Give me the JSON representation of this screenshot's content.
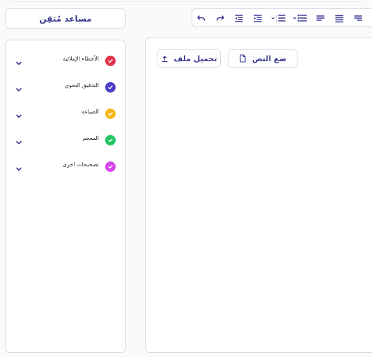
{
  "assistant_button": {
    "label": "مساعد مُتقِن"
  },
  "toolbar": {
    "icons": [
      "undo-icon",
      "redo-icon",
      "indent-decrease-icon",
      "indent-increase-icon",
      "numbered-list-icon",
      "bulleted-list-icon",
      "align-right-icon",
      "align-center-icon",
      "align-left-icon"
    ]
  },
  "sidebar": {
    "categories": [
      {
        "label": "الأخطاء الإملائية",
        "color": "#e0344a"
      },
      {
        "label": "التدقيق النحوي",
        "color": "#4c3fc9"
      },
      {
        "label": "الصياغة",
        "color": "#f5b91a"
      },
      {
        "label": "المعجم",
        "color": "#22c55e"
      },
      {
        "label": "تصحيحات اخرى",
        "color": "#d946ef"
      }
    ]
  },
  "editor": {
    "paste_label": "ضع النص",
    "upload_label": "تحميل ملف"
  },
  "colors": {
    "accent": "#3b3892",
    "border": "#d9d9e3"
  }
}
